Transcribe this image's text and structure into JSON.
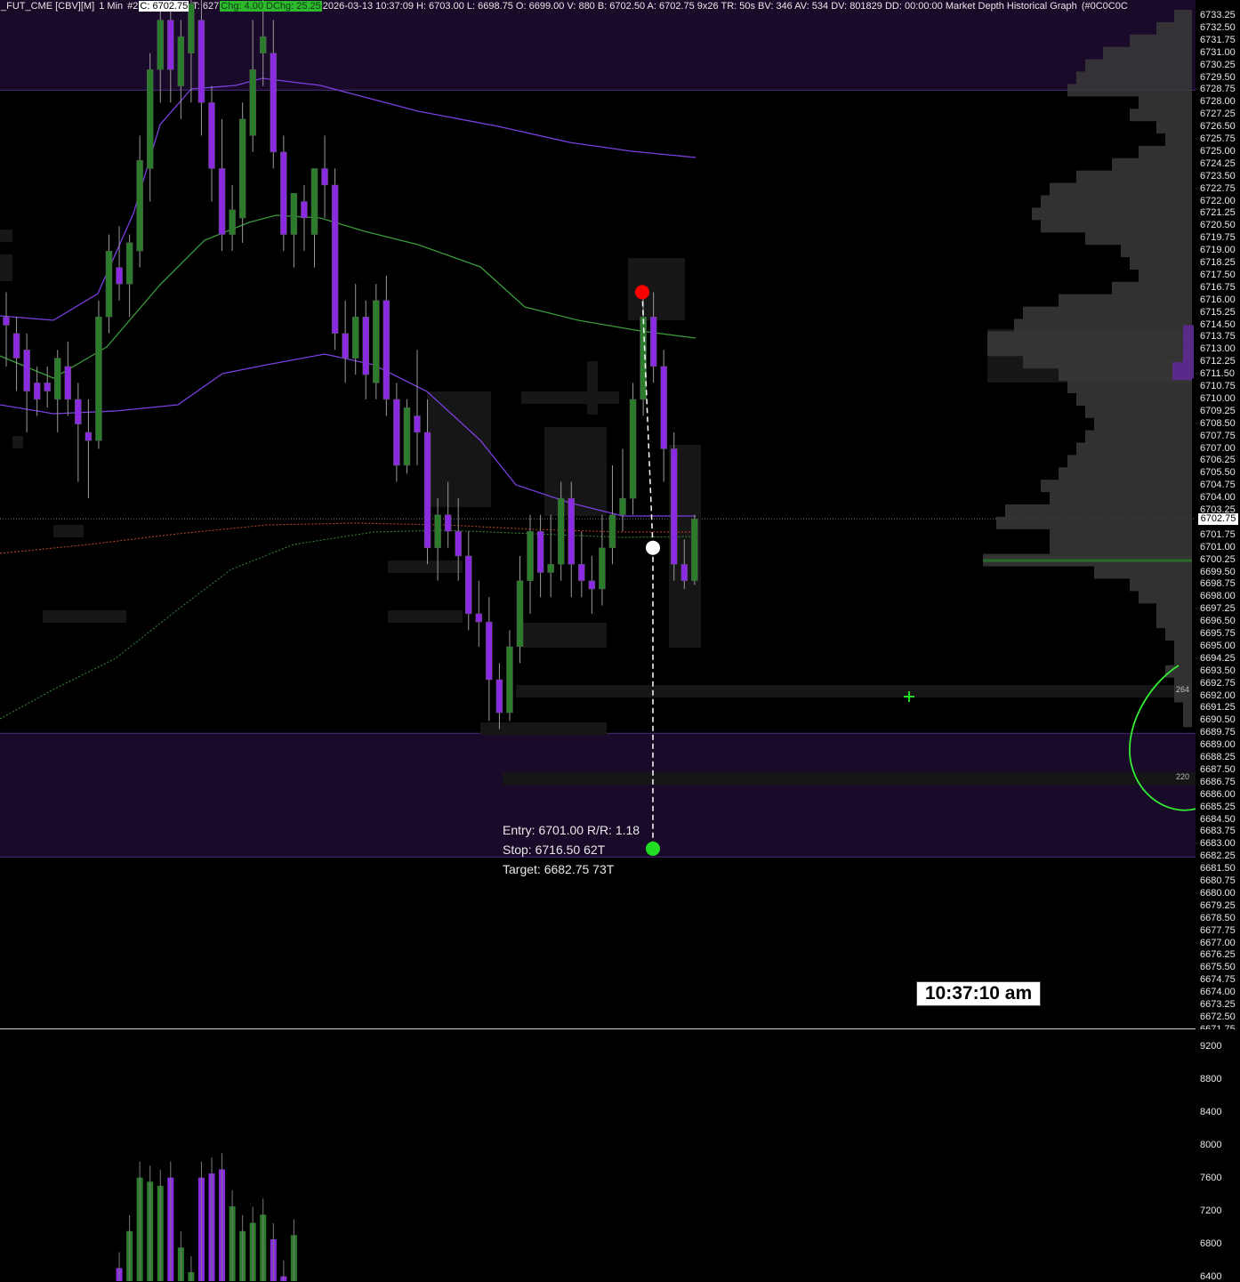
{
  "header": {
    "symbol": "_FUT_CME [CBV][M]",
    "interval": "1 Min",
    "chart_num": "#2",
    "close": "C: 6702.75",
    "trades": "T: 627",
    "chg": "Chg: 4.00 DChg: 25.25",
    "rest": "2026-03-13 10:37:09 H: 6703.00 L: 6698.75 O: 6699.00 V: 880 B: 6702.50 A: 6702.75 9x26 TR: 50s BV: 346 AV: 534 DV: 801829 DD: 00:00:00 Market Depth Historical Graph",
    "tail": "(#0C0C0C"
  },
  "price_axis": {
    "labels": [
      "6733.25",
      "6732.50",
      "6731.75",
      "6731.00",
      "6730.25",
      "6729.50",
      "6728.75",
      "6728.00",
      "6727.25",
      "6726.50",
      "6725.75",
      "6725.00",
      "6724.25",
      "6723.50",
      "6722.75",
      "6722.00",
      "6721.25",
      "6720.50",
      "6719.75",
      "6719.00",
      "6718.25",
      "6717.50",
      "6716.75",
      "6716.00",
      "6715.25",
      "6714.50",
      "6713.75",
      "6713.00",
      "6712.25",
      "6711.50",
      "6710.75",
      "6710.00",
      "6709.25",
      "6708.50",
      "6707.75",
      "6707.00",
      "6706.25",
      "6705.50",
      "6704.75",
      "6704.00",
      "6703.25",
      "6702.50",
      "6701.75",
      "6701.00",
      "6700.25",
      "6699.50",
      "6698.75",
      "6698.00",
      "6697.25",
      "6696.50",
      "6695.75",
      "6695.00",
      "6694.25",
      "6693.50",
      "6692.75",
      "6692.00",
      "6691.25",
      "6690.50",
      "6689.75",
      "6689.00",
      "6688.25",
      "6687.50",
      "6686.75",
      "6686.00",
      "6685.25",
      "6684.50",
      "6683.75",
      "6683.00",
      "6682.25",
      "6681.50",
      "6680.75",
      "6680.00",
      "6679.25",
      "6678.50",
      "6677.75",
      "6677.00",
      "6676.25",
      "6675.50",
      "6674.75",
      "6674.00",
      "6673.25",
      "6672.50",
      "6671.75"
    ],
    "current": "6702.75"
  },
  "volume_axis": {
    "labels": [
      "9200",
      "8800",
      "8400",
      "8000",
      "7600",
      "7200",
      "6800",
      "6400"
    ]
  },
  "trade": {
    "entry": "Entry: 6701.00  R/R: 1.18",
    "stop": "Stop: 6716.50  62T",
    "target": "Target: 6682.75  73T"
  },
  "profile_notes": {
    "upper": "264",
    "lower": "220"
  },
  "clock": "10:37:10 am",
  "colors": {
    "up": "#2b7d2b",
    "down": "#8a2be2",
    "zone": "#1a0a2a",
    "ma_purple": "#7b3fe0",
    "ma_green": "#3a9a3a",
    "marker_red": "#ff0000",
    "marker_green": "#22dd22",
    "profile": "#3a3a3a"
  },
  "candles": [
    [
      6715,
      6716.5,
      6712,
      6714.5
    ],
    [
      6714,
      6715,
      6710.5,
      6712.5
    ],
    [
      6713,
      6714,
      6708,
      6710.5
    ],
    [
      6711,
      6712,
      6709,
      6710
    ],
    [
      6711,
      6712,
      6709.5,
      6710.5
    ],
    [
      6710,
      6713,
      6708,
      6712.5
    ],
    [
      6712,
      6713.5,
      6709,
      6710
    ],
    [
      6710,
      6711,
      6705,
      6708.5
    ],
    [
      6708,
      6710,
      6704,
      6707.5
    ],
    [
      6707.5,
      6716,
      6707,
      6715
    ],
    [
      6715,
      6720,
      6714,
      6719
    ],
    [
      6718,
      6720.5,
      6716,
      6717
    ],
    [
      6717,
      6720,
      6715,
      6719.5
    ],
    [
      6719,
      6726,
      6718,
      6724.5
    ],
    [
      6724,
      6731,
      6722,
      6730
    ],
    [
      6730,
      6734,
      6728,
      6733
    ],
    [
      6733,
      6735,
      6728,
      6730
    ],
    [
      6729,
      6733,
      6727,
      6732
    ],
    [
      6731,
      6735,
      6728,
      6734
    ],
    [
      6733,
      6736,
      6726,
      6728
    ],
    [
      6728,
      6729,
      6722,
      6724
    ],
    [
      6724,
      6727,
      6719,
      6720
    ],
    [
      6720,
      6723,
      6719,
      6721.5
    ],
    [
      6721,
      6728,
      6719.5,
      6727
    ],
    [
      6726,
      6733,
      6725,
      6730
    ],
    [
      6731,
      6735,
      6729,
      6732
    ],
    [
      6731,
      6733,
      6724,
      6725
    ],
    [
      6725,
      6726,
      6719,
      6720
    ],
    [
      6720,
      6722,
      6718,
      6722.5
    ],
    [
      6722,
      6723,
      6719,
      6721
    ],
    [
      6720,
      6724,
      6718,
      6724
    ],
    [
      6724,
      6726,
      6721,
      6723
    ],
    [
      6723,
      6724,
      6713,
      6714
    ],
    [
      6714,
      6716,
      6711,
      6712.5
    ],
    [
      6712.5,
      6717,
      6711.5,
      6715
    ],
    [
      6715,
      6716,
      6710,
      6711.5
    ],
    [
      6711,
      6717,
      6710,
      6716
    ],
    [
      6716,
      6717.5,
      6709,
      6710
    ],
    [
      6710,
      6711,
      6705,
      6706
    ],
    [
      6706,
      6710,
      6705.5,
      6709.5
    ],
    [
      6709,
      6713,
      6706,
      6708
    ],
    [
      6708,
      6710,
      6700,
      6701
    ],
    [
      6701,
      6704,
      6699,
      6703
    ],
    [
      6703,
      6705,
      6701,
      6702
    ],
    [
      6702,
      6704,
      6699,
      6700.5
    ],
    [
      6700.5,
      6702,
      6696,
      6697
    ],
    [
      6697,
      6699,
      6695,
      6696.5
    ],
    [
      6696.5,
      6698,
      6690.5,
      6693
    ],
    [
      6693,
      6694,
      6690,
      6691
    ],
    [
      6691,
      6696,
      6690.5,
      6695
    ],
    [
      6695,
      6700.5,
      6694,
      6699
    ],
    [
      6699,
      6703,
      6697,
      6702
    ],
    [
      6702,
      6703,
      6698,
      6699.5
    ],
    [
      6699.5,
      6703,
      6698,
      6700
    ],
    [
      6700,
      6705,
      6699,
      6704
    ],
    [
      6704,
      6705,
      6698,
      6700
    ],
    [
      6700,
      6702,
      6698,
      6699
    ],
    [
      6699,
      6700.5,
      6697,
      6698.5
    ],
    [
      6698.5,
      6703,
      6697.5,
      6701
    ],
    [
      6701,
      6706,
      6700,
      6703
    ],
    [
      6703,
      6707,
      6702,
      6704
    ],
    [
      6704,
      6711,
      6703,
      6710
    ],
    [
      6710,
      6716.5,
      6709,
      6715
    ],
    [
      6715,
      6716.5,
      6711,
      6712
    ],
    [
      6712,
      6713,
      6705,
      6707
    ],
    [
      6707,
      6708,
      6699,
      6700
    ],
    [
      6700,
      6701.5,
      6698.5,
      6699
    ],
    [
      6699,
      6703,
      6698.75,
      6702.75
    ]
  ],
  "volumes": [
    6450,
    6900,
    7550,
    7500,
    7450,
    7550,
    6700,
    6400,
    7550,
    7600,
    7650,
    7200,
    6900,
    7000,
    7100,
    6800,
    6350,
    6850
  ]
}
